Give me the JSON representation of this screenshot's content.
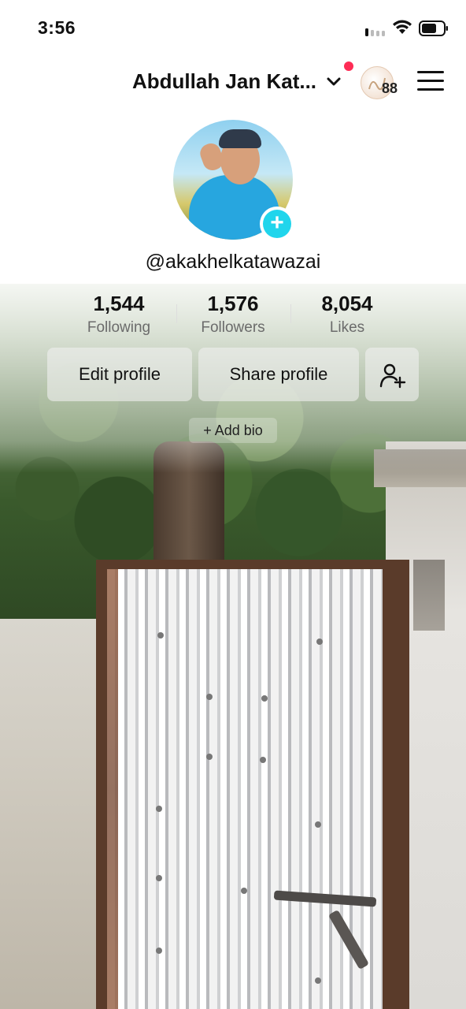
{
  "status_bar": {
    "time": "3:56"
  },
  "header": {
    "display_name": "Abdullah Jan Kat...",
    "notification_count": "88"
  },
  "profile": {
    "username": "@akakhelkatawazai"
  },
  "stats": [
    {
      "value": "1,544",
      "label": "Following"
    },
    {
      "value": "1,576",
      "label": "Followers"
    },
    {
      "value": "8,054",
      "label": "Likes"
    }
  ],
  "actions": {
    "edit_profile": "Edit profile",
    "share_profile": "Share profile",
    "add_bio": "+ Add bio"
  },
  "colors": {
    "notification_dot": "#fe2c55",
    "add_avatar": "#20d5ec"
  }
}
